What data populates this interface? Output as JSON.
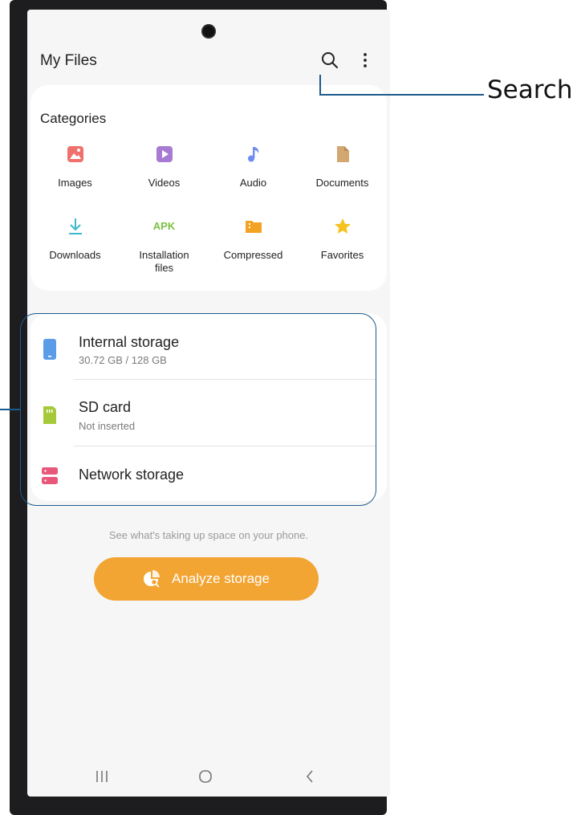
{
  "app": {
    "title": "My Files"
  },
  "toolbar": {
    "search_icon": "search-icon",
    "more_icon": "more-options-icon"
  },
  "categories": {
    "title": "Categories",
    "items": [
      {
        "label": "Images",
        "icon": "images-icon",
        "color": "#f0706b"
      },
      {
        "label": "Videos",
        "icon": "videos-icon",
        "color": "#a77bd3"
      },
      {
        "label": "Audio",
        "icon": "audio-icon",
        "color": "#6f8cf0"
      },
      {
        "label": "Documents",
        "icon": "documents-icon",
        "color": "#d3a770"
      },
      {
        "label": "Downloads",
        "icon": "downloads-icon",
        "color": "#3ab8cf"
      },
      {
        "label": "Installation\nfiles",
        "icon": "apk-icon",
        "color": "#7ac143",
        "text": "APK"
      },
      {
        "label": "Compressed",
        "icon": "compressed-icon",
        "color": "#f2a324"
      },
      {
        "label": "Favorites",
        "icon": "favorites-icon",
        "color": "#f6c21e"
      }
    ]
  },
  "storage": [
    {
      "title": "Internal storage",
      "subtitle": "30.72 GB / 128 GB",
      "icon": "phone-storage-icon",
      "color": "#5a9ce8"
    },
    {
      "title": "SD card",
      "subtitle": "Not inserted",
      "icon": "sd-card-icon",
      "color": "#a6c93a"
    },
    {
      "title": "Network storage",
      "subtitle": "",
      "icon": "network-storage-icon",
      "color": "#e8587a"
    }
  ],
  "hint": "See what's taking up space on your phone.",
  "analyze": {
    "label": "Analyze storage",
    "color": "#f2a533"
  },
  "navbar": {
    "recent_icon": "recent-apps-icon",
    "home_icon": "home-icon",
    "back_icon": "back-icon"
  },
  "callout": {
    "label": "Search"
  }
}
